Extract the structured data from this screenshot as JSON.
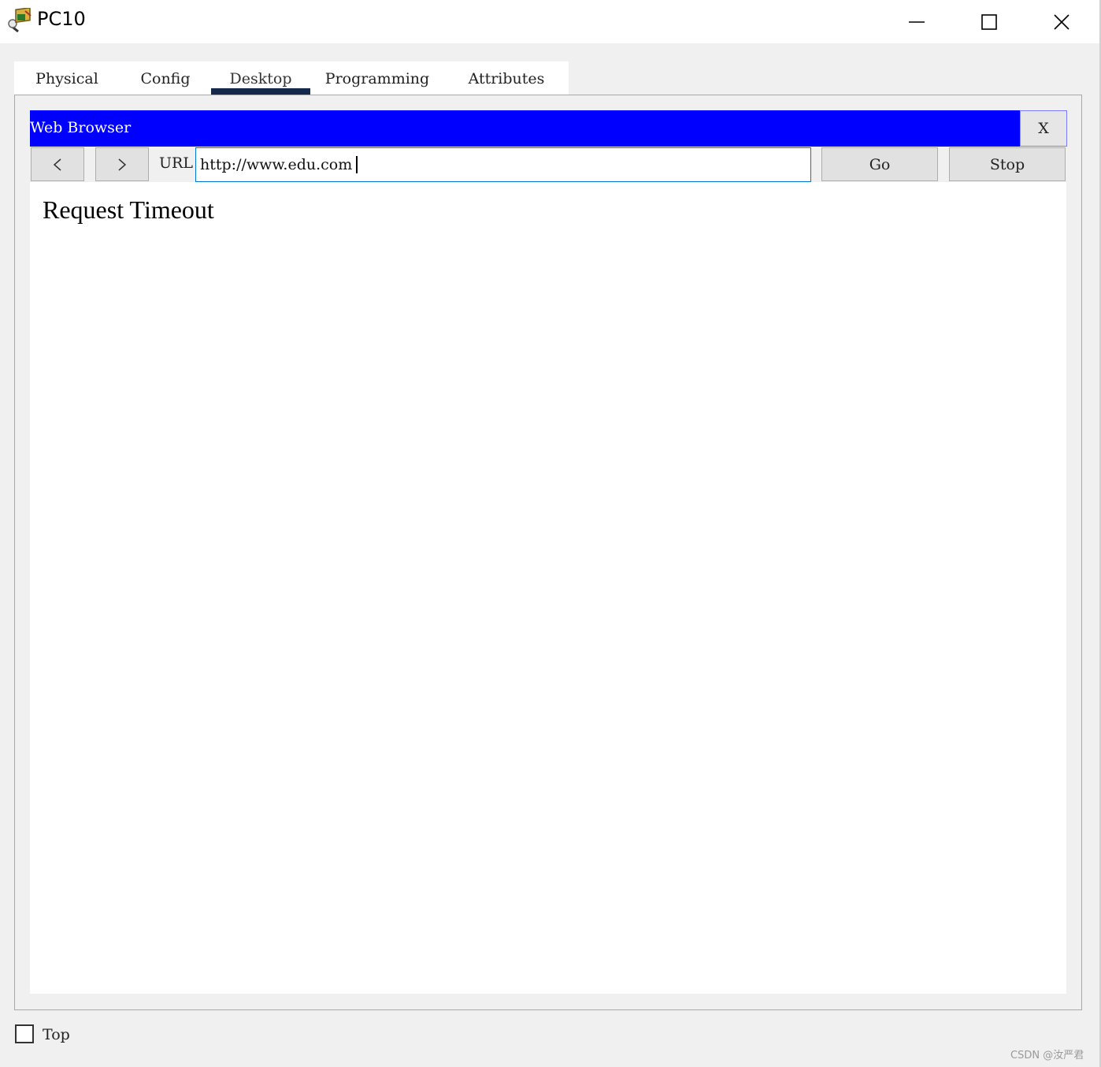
{
  "window": {
    "title": "PC10",
    "icon": "packet-tracer-pc-icon",
    "controls": [
      "minimize-icon",
      "maximize-icon",
      "close-icon"
    ]
  },
  "tabs": [
    {
      "label": "Physical",
      "active": false
    },
    {
      "label": "Config",
      "active": false
    },
    {
      "label": "Desktop",
      "active": true
    },
    {
      "label": "Programming",
      "active": false
    },
    {
      "label": "Attributes",
      "active": false
    }
  ],
  "browser": {
    "title": "Web Browser",
    "close_label": "X",
    "back_icon": "chevron-left-icon",
    "forward_icon": "chevron-right-icon",
    "url_label": "URL",
    "url_value": "http://www.edu.com",
    "go_label": "Go",
    "stop_label": "Stop",
    "page_text": "Request Timeout"
  },
  "footer": {
    "top_label": "Top",
    "top_checked": false,
    "watermark": "CSDN @汝严君"
  },
  "colors": {
    "browser_bar": "#0000ff",
    "active_tab_indicator": "#13284a",
    "background": "#f0f0f0"
  }
}
